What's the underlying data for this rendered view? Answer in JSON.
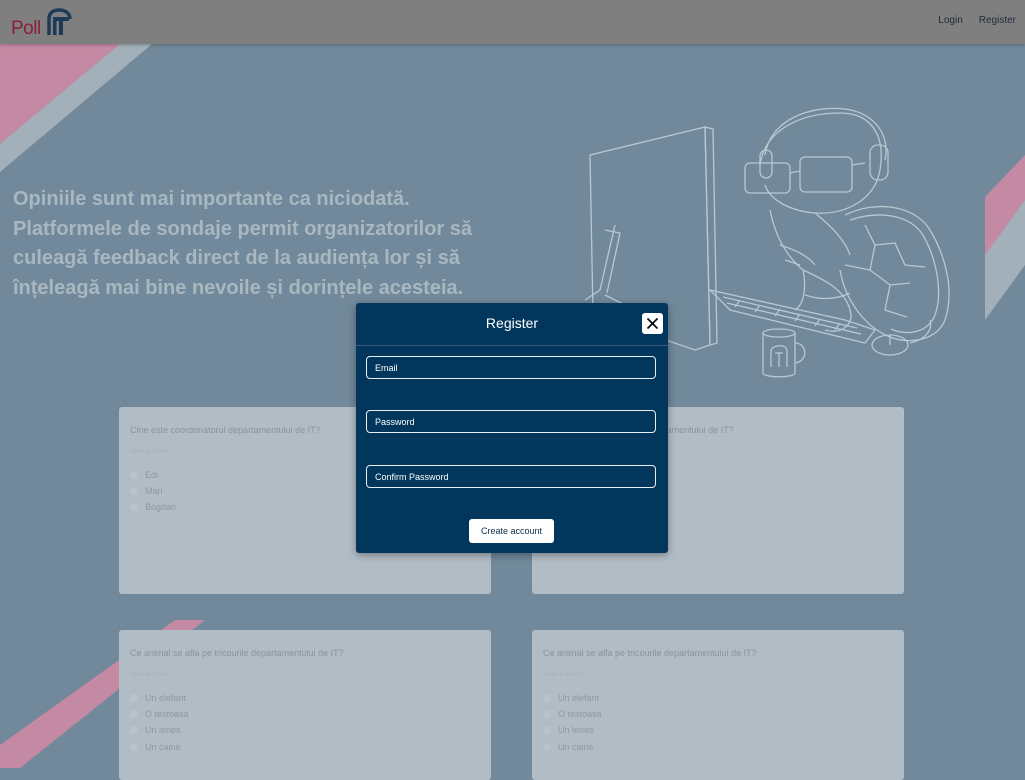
{
  "header": {
    "logo_text": "Poll",
    "logo_mark": "IT",
    "nav": {
      "login": "Login",
      "register": "Register"
    }
  },
  "hero": {
    "text": "Opiniile sunt mai importante ca niciodată. Platformele de sondaje permit organizatorilor să culeagă feedback direct de la audiența lor și să înțeleagă mai bine nevoile și dorințele acesteia."
  },
  "polls": [
    {
      "question": "Cine este coordonatorul departamentului de IT?",
      "hint": "Make a choice:",
      "options": [
        "Edi",
        "Mari",
        "Bogdan"
      ]
    },
    {
      "question": "Cine este coordonatorul departamentului de IT?",
      "hint": "",
      "options": []
    },
    {
      "question": "Ce animal se afla pe tricourile departamentului de IT?",
      "hint": "Make a choice:",
      "options": [
        "Un elefant",
        "O testoasa",
        "Un lenes",
        "Un caine"
      ]
    },
    {
      "question": "Ce animal se afla pe tricourile departamentului de IT?",
      "hint": "Make a choice:",
      "options": [
        "Un elefant",
        "O testoasa",
        "Un lenes",
        "Un caine"
      ]
    }
  ],
  "modal": {
    "title": "Register",
    "email_placeholder": "Email",
    "password_placeholder": "Password",
    "confirm_placeholder": "Confirm Password",
    "submit_label": "Create account"
  },
  "colors": {
    "header_bg": "#7f7f7f",
    "page_bg": "#71899a",
    "modal_bg": "#02365d",
    "brand": "#8a1f3c",
    "accent_pink": "#c48aa3"
  },
  "icons": [
    "close-icon",
    "turtle-illustration"
  ]
}
